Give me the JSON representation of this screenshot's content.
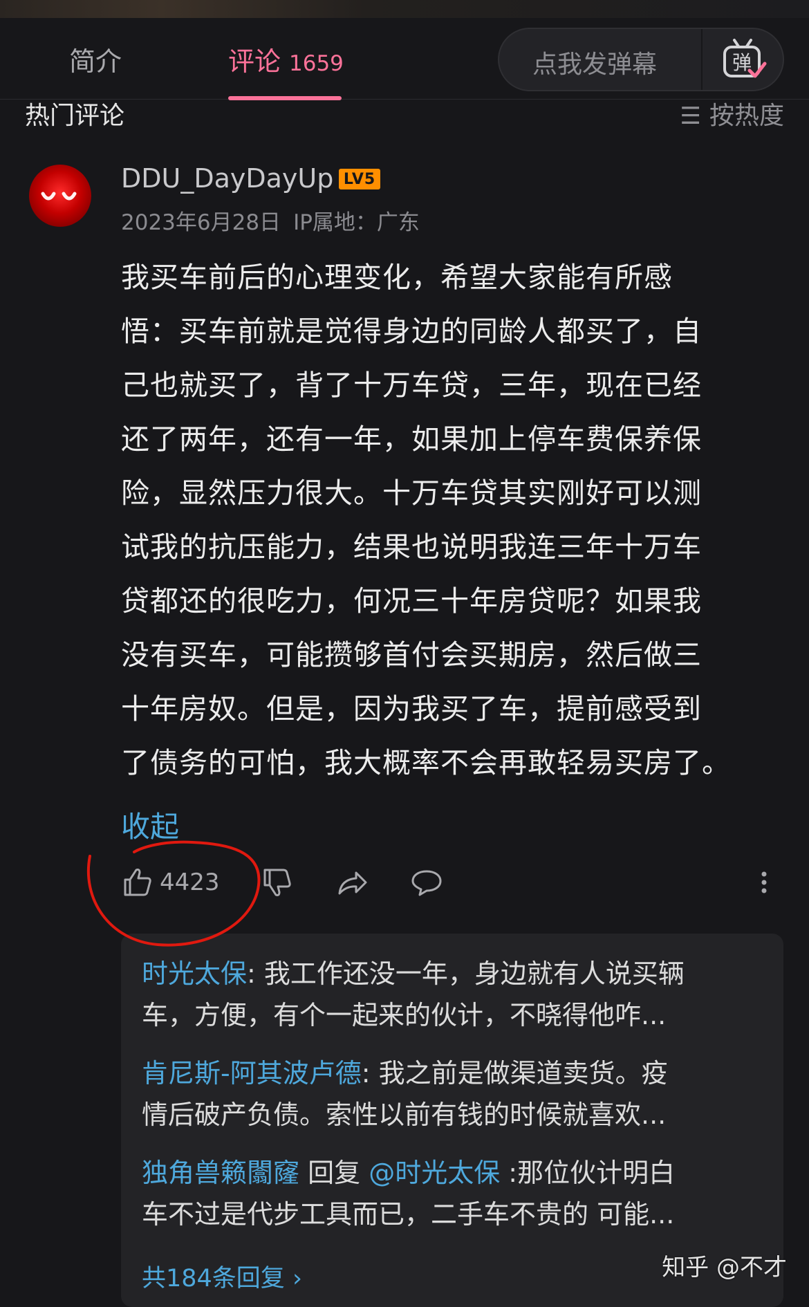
{
  "tabs": {
    "intro_label": "简介",
    "comments_label": "评论",
    "comments_count": "1659"
  },
  "danmaku": {
    "placeholder": "点我发弹幕",
    "icon": "danmaku-icon"
  },
  "section": {
    "title": "热门评论",
    "sort_label": "按热度",
    "sort_icon": "sort-lines-icon"
  },
  "comment": {
    "username": "DDU_DayDayUp",
    "level": "LV5",
    "date": "2023年6月28日",
    "ip": "IP属地：广东",
    "lines": [
      "我买车前后的心理变化，希望大家能有所感",
      "悟：买车前就是觉得身边的同龄人都买了，自",
      "己也就买了，背了十万车贷，三年，现在已经",
      "还了两年，还有一年，如果加上停车费保养保",
      "险，显然压力很大。十万车贷其实刚好可以测",
      "试我的抗压能力，结果也说明我连三年十万车",
      "贷都还的很吃力，何况三十年房贷呢？如果我",
      "没有买车，可能攒够首付会买期房，然后做三",
      "十年房奴。但是，因为我买了车，提前感受到",
      "了债务的可怕，我大概率不会再敢轻易买房了。"
    ],
    "collapse_label": "收起",
    "like_count": "4423"
  },
  "replies": [
    {
      "name": "时光太保",
      "line1": ": 我工作还没一年，身边就有人说买辆",
      "line2": "车，方便，有个一起来的伙计，不晓得他咋..."
    },
    {
      "name": "肯尼斯-阿其波卢德",
      "line1": ": 我之前是做渠道卖货。疫",
      "line2": "情后破产负债。索性以前有钱的时候就喜欢..."
    },
    {
      "name": "独角兽籁闟窿",
      "reply_word": " 回复 ",
      "mention": "@时光太保",
      "line1": " :那位伙计明白",
      "line2": "车不过是代步工具而已，二手车不贵的 可能..."
    }
  ],
  "reply_total": "共184条回复",
  "watermark": "知乎 @不才",
  "colors": {
    "accent_pink": "#fb7299",
    "link_blue": "#4ea8dc",
    "level_orange": "#ff8f00",
    "annotation_red": "#e0190f"
  }
}
